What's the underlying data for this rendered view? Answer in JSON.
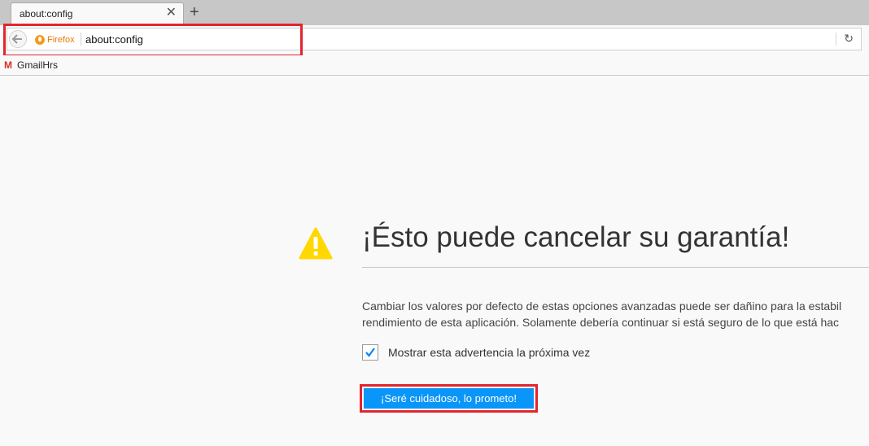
{
  "tab": {
    "title": "about:config",
    "close": "✕",
    "new_tab": "+"
  },
  "navbar": {
    "identity_label": "Firefox",
    "url": "about:config",
    "reload": "↻"
  },
  "bookmarks": [
    {
      "label": "GmailHrs",
      "icon": "gmail-icon",
      "glyph": "M"
    }
  ],
  "content": {
    "title": "¡Ésto puede cancelar su garantía!",
    "description_lines": [
      "Cambiar los valores por defecto de estas opciones avanzadas puede ser dañino para la estabil",
      "rendimiento de esta aplicación. Solamente debería continuar si está seguro de lo que está hac"
    ],
    "checkbox": {
      "label": "Mostrar esta advertencia la próxima vez",
      "checked": true
    },
    "button_label": "¡Seré cuidadoso, lo prometo!"
  },
  "colors": {
    "highlight": "#e1252e",
    "button": "#0996f8",
    "warning": "#ffd800",
    "firefox": "#f39b1f"
  }
}
